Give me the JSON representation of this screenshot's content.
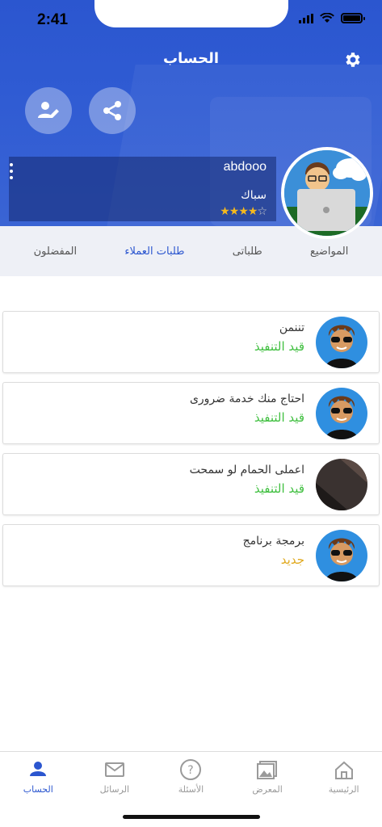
{
  "status": {
    "time": "2:41"
  },
  "header": {
    "title": "الحساب"
  },
  "profile": {
    "username": "abdooo",
    "profession": "سباك",
    "rating": 4,
    "rating_max": 5
  },
  "tabs": [
    {
      "label": "المواضيع",
      "active": false
    },
    {
      "label": "طلباتى",
      "active": false
    },
    {
      "label": "طلبات العملاء",
      "active": true
    },
    {
      "label": "المفضلون",
      "active": false
    }
  ],
  "requests": [
    {
      "title": "تننمن",
      "status": "قيد التنفيذ",
      "status_color": "#3fbf3f",
      "avatar": "cartoon-boy"
    },
    {
      "title": "احتاج منك خدمة ضرورى",
      "status": "قيد التنفيذ",
      "status_color": "#3fbf3f",
      "avatar": "cartoon-boy"
    },
    {
      "title": "اعملى الحمام لو سمحت",
      "status": "قيد التنفيذ",
      "status_color": "#3fbf3f",
      "avatar": "dark-photo"
    },
    {
      "title": "برمجة برنامج",
      "status": "جديد",
      "status_color": "#e0a81c",
      "avatar": "cartoon-boy"
    }
  ],
  "bottom_nav": [
    {
      "label": "الرئيسية",
      "icon": "home-icon",
      "active": false
    },
    {
      "label": "المعرض",
      "icon": "gallery-icon",
      "active": false
    },
    {
      "label": "الأسئلة",
      "icon": "question-icon",
      "active": false
    },
    {
      "label": "الرسائل",
      "icon": "mail-icon",
      "active": false
    },
    {
      "label": "الحساب",
      "icon": "person-icon",
      "active": true
    }
  ],
  "colors": {
    "primary": "#2b56cf",
    "in_progress": "#3fbf3f",
    "new": "#e0a81c"
  }
}
